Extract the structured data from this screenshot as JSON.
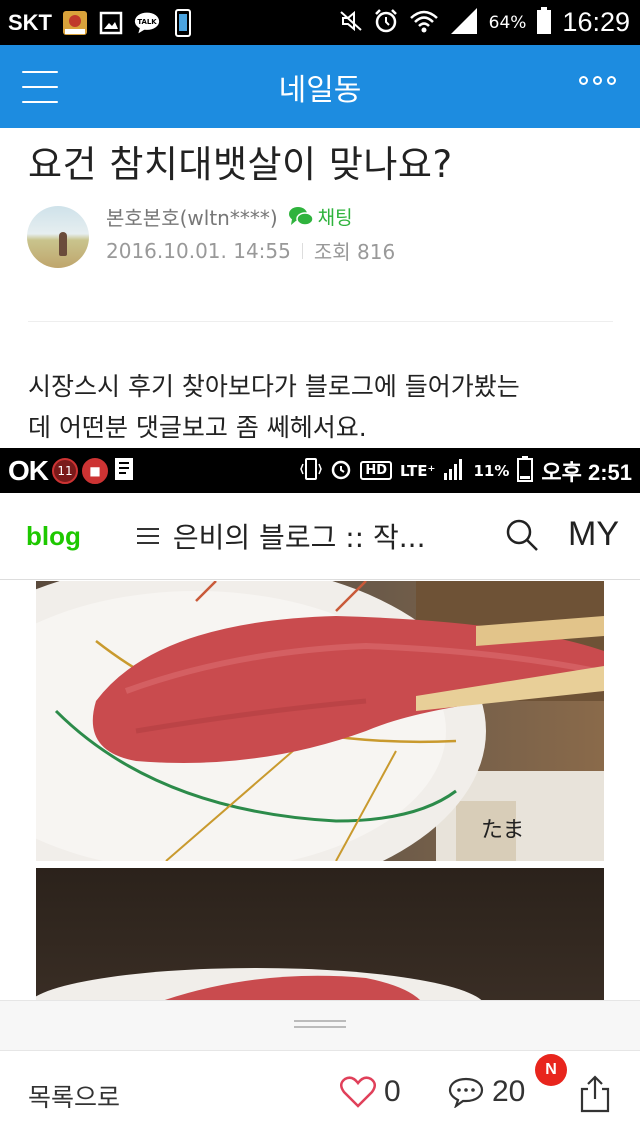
{
  "status_bar": {
    "carrier": "SKT",
    "battery": "64%",
    "time": "16:29",
    "icons": [
      "app-icon",
      "gallery-icon",
      "talk-icon",
      "phone-icon",
      "mute-icon",
      "alarm-icon",
      "wifi-icon",
      "signal-icon",
      "battery-icon"
    ]
  },
  "header": {
    "title": "네일동",
    "menu_icon": "hamburger-icon",
    "more_icon": "more-dots-icon",
    "accent_color": "#1d8ce0"
  },
  "post": {
    "title": "요건 참치대뱃살이 맞나요?",
    "author": "본호본호(wltn****)",
    "chat_label": "채팅",
    "date": "2016.10.01. 14:55",
    "views": "조회 816",
    "body_line1": "시장스시 후기 찾아보다가 블로그에 들어가봤는",
    "body_line2": "데 어떤분 댓글보고 좀 쎄헤서요."
  },
  "embedded": {
    "status_logo": "OK",
    "status_badge": "11",
    "status_hd": "HD",
    "status_lte": "LTE⁺",
    "status_battery": "11%",
    "status_time": "오후 2:51",
    "blog_logo": "blog",
    "blog_title": "은비의 블로그 :: 작...",
    "my_label": "MY",
    "photo_text": "たま"
  },
  "toolbar": {
    "list_label": "목록으로",
    "like_count": "0",
    "comment_count": "20",
    "new_badge": "N",
    "badge_color": "#e8251d"
  }
}
